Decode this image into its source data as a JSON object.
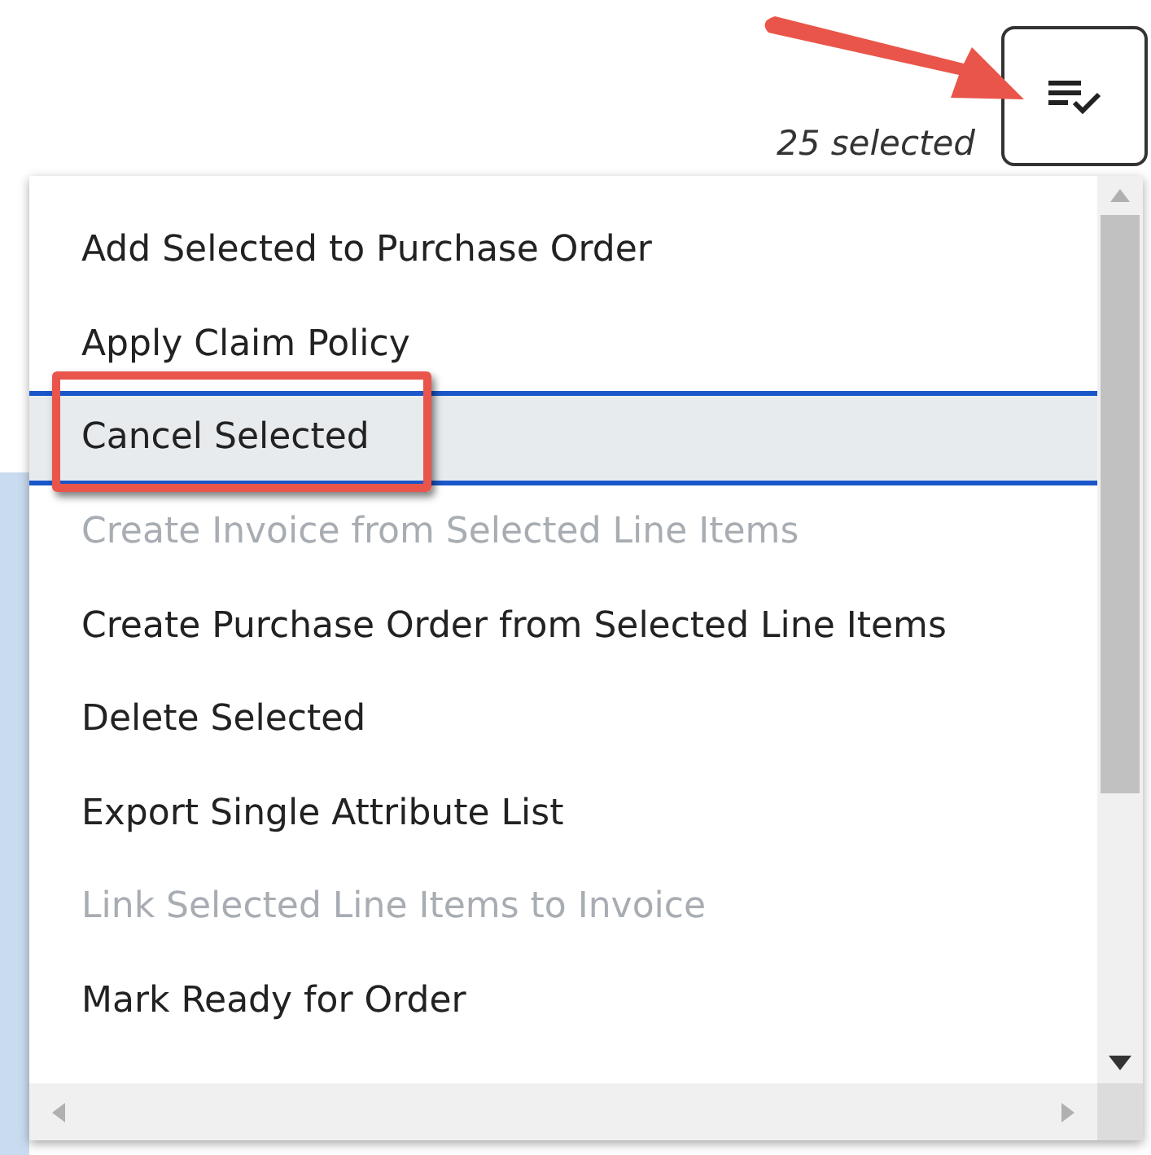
{
  "selection_count": "25 selected",
  "menu": {
    "items": [
      {
        "label": "Add Selected to Purchase Order",
        "selected": false,
        "disabled": false
      },
      {
        "label": "Apply Claim Policy",
        "selected": false,
        "disabled": false
      },
      {
        "label": "Cancel Selected",
        "selected": true,
        "disabled": false
      },
      {
        "label": "Create Invoice from Selected Line Items",
        "selected": false,
        "disabled": true
      },
      {
        "label": "Create Purchase Order from Selected Line Items",
        "selected": false,
        "disabled": false
      },
      {
        "label": "Delete Selected",
        "selected": false,
        "disabled": false
      },
      {
        "label": "Export Single Attribute List",
        "selected": false,
        "disabled": false
      },
      {
        "label": "Link Selected Line Items to Invoice",
        "selected": false,
        "disabled": true
      },
      {
        "label": "Mark Ready for Order",
        "selected": false,
        "disabled": false
      }
    ]
  }
}
